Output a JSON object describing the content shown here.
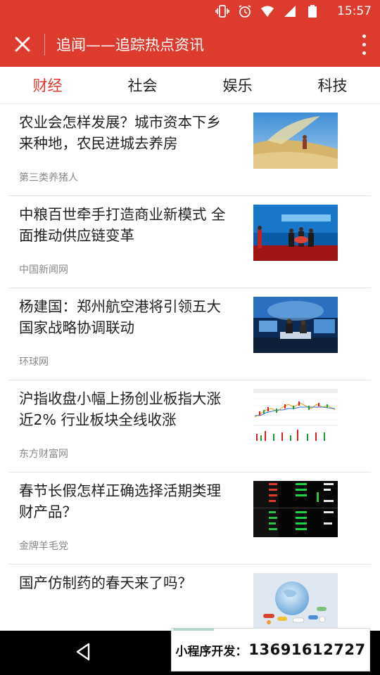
{
  "status_bar": {
    "time": "15:57",
    "icons": [
      "vibrate-icon",
      "alarm-icon",
      "wifi-icon",
      "signal-icon",
      "battery-icon"
    ]
  },
  "app_bar": {
    "title": "追闻——追踪热点资讯",
    "close_icon": "close-icon",
    "more_icon": "more-vertical-icon",
    "background": "#dd3b2e"
  },
  "tabs": [
    {
      "label": "财经",
      "active": true
    },
    {
      "label": "社会",
      "active": false
    },
    {
      "label": "娱乐",
      "active": false
    },
    {
      "label": "科技",
      "active": false
    }
  ],
  "colors": {
    "accent": "#dd3b2e",
    "text": "#222222",
    "source": "#888888"
  },
  "news": [
    {
      "title": "农业会怎样发展？城市资本下乡来种地，农民进城去养房",
      "source": "第三类养猪人",
      "thumb": "grain-photo"
    },
    {
      "title": "中粮百世牵手打造商业新模式 全面推动供应链变革",
      "source": "中国新闻网",
      "thumb": "press-conference-photo"
    },
    {
      "title": "杨建国：郑州航空港将引领五大国家战略协调联动",
      "source": "环球网",
      "thumb": "tv-studio-photo"
    },
    {
      "title": "沪指收盘小幅上扬创业板指大涨近2% 行业板块全线收涨",
      "source": "东方财富网",
      "thumb": "stock-chart-photo"
    },
    {
      "title": "春节长假怎样正确选择活期类理财产品？",
      "source": "金牌羊毛党",
      "thumb": "stock-quote-screen-photo"
    },
    {
      "title": "国产仿制药的春天来了吗？",
      "source": "",
      "thumb": "medicine-globe-photo"
    }
  ],
  "nav": {
    "back_icon": "back-triangle-icon"
  },
  "promo": {
    "label": "小程序开发：",
    "phone": "13691612727"
  }
}
